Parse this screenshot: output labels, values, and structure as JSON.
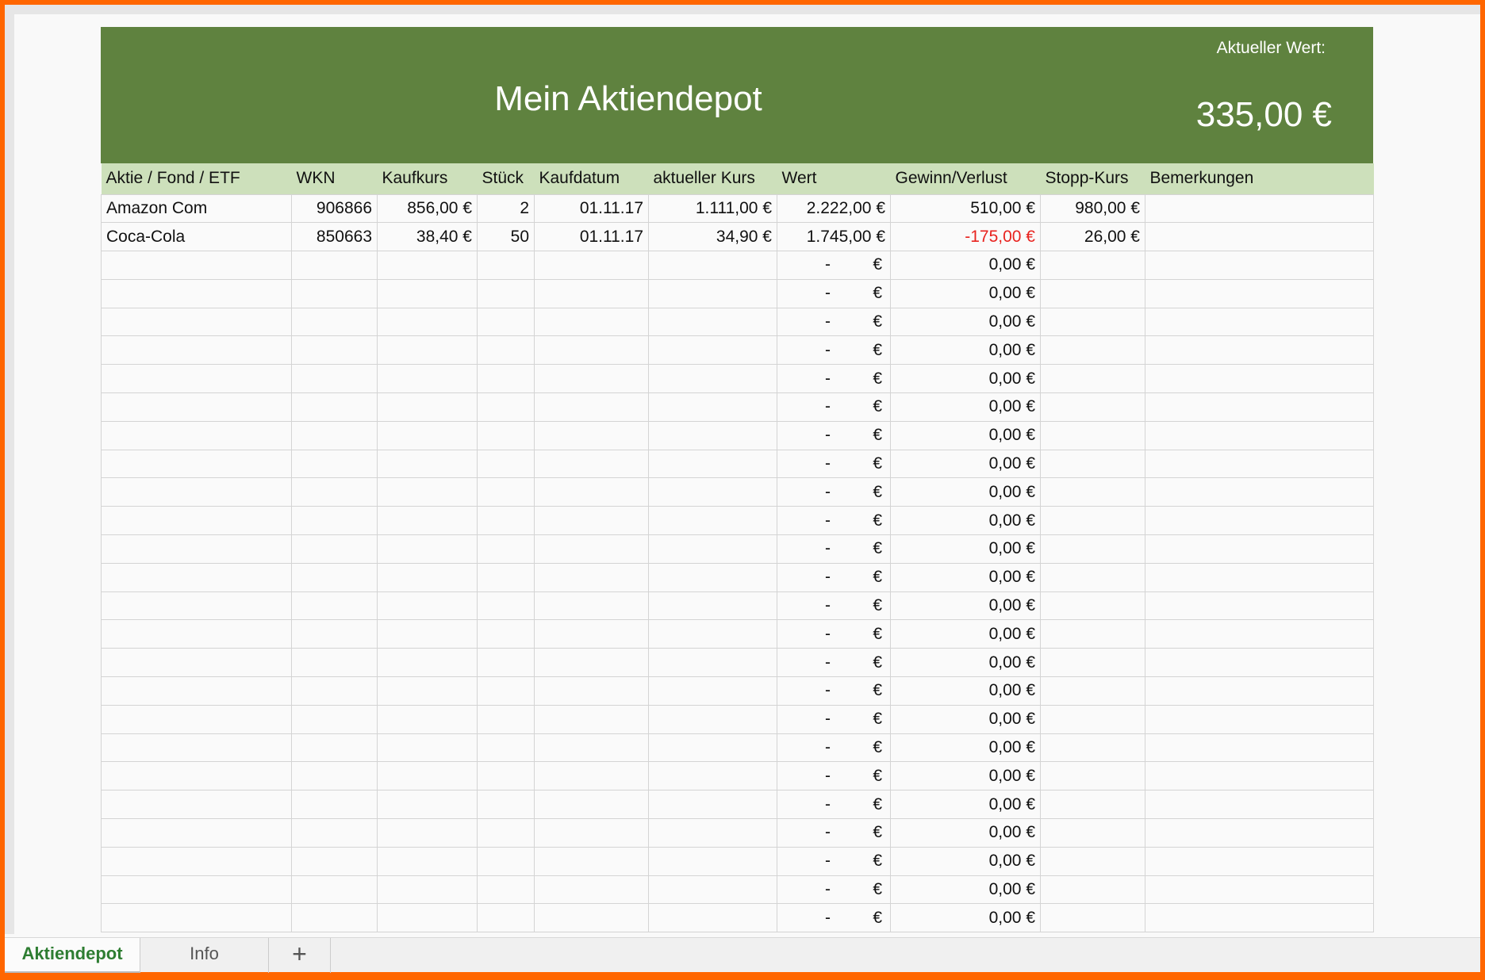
{
  "header": {
    "title": "Mein Aktiendepot",
    "current_value_label": "Aktueller Wert:",
    "current_value": "335,00 €"
  },
  "columns": [
    "Aktie / Fond / ETF",
    "WKN",
    "Kaufkurs",
    "Stück",
    "Kaufdatum",
    "aktueller Kurs",
    "Wert",
    "Gewinn/Verlust",
    "Stopp-Kurs",
    "Bemerkungen"
  ],
  "rows": [
    [
      "Amazon Com",
      "906866",
      "856,00 €",
      "2",
      "01.11.17",
      "1.111,00 €",
      "2.222,00 €",
      "510,00 €",
      "980,00 €",
      ""
    ],
    [
      "Coca-Cola",
      "850663",
      "38,40 €",
      "50",
      "01.11.17",
      "34,90 €",
      "1.745,00 €",
      "-175,00 €",
      "26,00 €",
      ""
    ]
  ],
  "empty_row": {
    "wert_dash": "-",
    "wert_currency": "€",
    "gewinn": "0,00 €"
  },
  "empty_row_count": 24,
  "colors": {
    "banner": "#5f823f",
    "header_row": "#cde0bb",
    "negative": "#e8231f"
  },
  "tabs": {
    "active": "Aktiendepot",
    "second": "Info",
    "add": "+"
  }
}
